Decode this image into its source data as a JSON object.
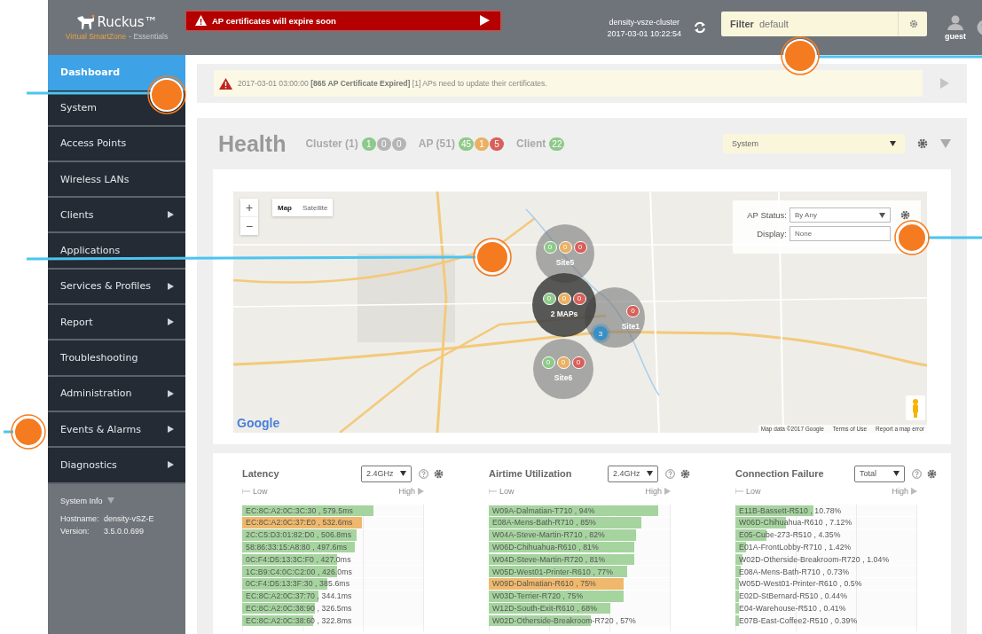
{
  "header": {
    "brand": "Ruckus™",
    "product": "Virtual SmartZone",
    "edition": "- Essentials",
    "alert": "AP certificates will expire soon",
    "cluster": "density-vsze-cluster",
    "datetime": "2017-03-01  10:22:54",
    "filter_label": "Filter",
    "filter_value": "default",
    "user": "guest"
  },
  "sidebar": {
    "items": [
      {
        "label": "Dashboard",
        "selected": true,
        "has_submenu": false
      },
      {
        "label": "System",
        "selected": false,
        "has_submenu": false
      },
      {
        "label": "Access Points",
        "selected": false,
        "has_submenu": false
      },
      {
        "label": "Wireless LANs",
        "selected": false,
        "has_submenu": false
      },
      {
        "label": "Clients",
        "selected": false,
        "has_submenu": true
      },
      {
        "label": "Applications",
        "selected": false,
        "has_submenu": false
      },
      {
        "label": "Services & Profiles",
        "selected": false,
        "has_submenu": true
      },
      {
        "label": "Report",
        "selected": false,
        "has_submenu": true
      },
      {
        "label": "Troubleshooting",
        "selected": false,
        "has_submenu": false
      },
      {
        "label": "Administration",
        "selected": false,
        "has_submenu": true
      },
      {
        "label": "Events & Alarms",
        "selected": false,
        "has_submenu": true
      },
      {
        "label": "Diagnostics",
        "selected": false,
        "has_submenu": true
      }
    ],
    "system_info": {
      "title": "System Info",
      "rows": [
        {
          "label": "Hostname:",
          "value": "density-vSZ-E"
        },
        {
          "label": "Version:",
          "value": "3.5.0.0.699"
        }
      ]
    }
  },
  "event_banner": {
    "message": "2017-03-01 03:00:00 **[865 AP Certificate Expired]** [1] APs need to update their certificates."
  },
  "health": {
    "title": "Health",
    "scope_select": "System",
    "groups": [
      {
        "label": "Cluster (1)",
        "badges": [
          {
            "value": "1",
            "color": "#8fc98a"
          },
          {
            "value": "0",
            "color": "#b5b5b5"
          },
          {
            "value": "0",
            "color": "#b5b5b5"
          }
        ]
      },
      {
        "label": "AP (51)",
        "badges": [
          {
            "value": "45",
            "color": "#8fc98a"
          },
          {
            "value": "1",
            "color": "#eab064"
          },
          {
            "value": "5",
            "color": "#d9605a"
          }
        ]
      },
      {
        "label": "Client",
        "badges": [
          {
            "value": "22",
            "color": "#8fc98a"
          }
        ]
      }
    ]
  },
  "map": {
    "zoom_in": "+",
    "zoom_out": "−",
    "map_types": [
      {
        "label": "Map",
        "selected": true
      },
      {
        "label": "Satellite",
        "selected": false
      }
    ],
    "ap_status": {
      "label": "AP Status:",
      "value": "By Any"
    },
    "display": {
      "label": "Display:",
      "value": "None"
    },
    "clusters": [
      {
        "kind": "site",
        "label": "Site5",
        "badges": [
          {
            "value": "0",
            "color": "#8fc98a"
          },
          {
            "value": "0",
            "color": "#eab064"
          },
          {
            "value": "0",
            "color": "#d9605a"
          }
        ]
      },
      {
        "kind": "site",
        "label": "Site1",
        "badges": [
          {
            "value": "0",
            "color": "#d9605a"
          }
        ]
      },
      {
        "kind": "group",
        "label": "2 MAPs",
        "badges": [
          {
            "value": "0",
            "color": "#8fc98a"
          },
          {
            "value": "0",
            "color": "#eab064"
          },
          {
            "value": "0",
            "color": "#d9605a"
          }
        ]
      },
      {
        "kind": "site",
        "label": "Site6",
        "badges": [
          {
            "value": "0",
            "color": "#8fc98a"
          },
          {
            "value": "0",
            "color": "#eab064"
          },
          {
            "value": "0",
            "color": "#d9605a"
          }
        ]
      }
    ],
    "ap_marker": "3",
    "logo": "Google",
    "attribution": "Map data ©2017 Google",
    "terms": "Terms of Use",
    "report": "Report a map error"
  },
  "widgets": [
    {
      "title": "Latency",
      "select": "2.4GHz",
      "low": "Low",
      "high": "High",
      "rows": [
        {
          "label": "EC:8C:A2:0C:3C:30 , 579.5ms",
          "level": 0.72,
          "color": "#a6d49f"
        },
        {
          "label": "EC:8C:A2:0C:37:E0 , 532.6ms",
          "level": 0.66,
          "color": "#efb86c"
        },
        {
          "label": "2C:C5:D3:01:82:D0 , 506.8ms",
          "level": 0.63,
          "color": "#a6d49f"
        },
        {
          "label": "58:86:33:15:A8:80 , 497.6ms",
          "level": 0.62,
          "color": "#a6d49f"
        },
        {
          "label": "0C:F4:D5:13:3C:F0 , 427.0ms",
          "level": 0.52,
          "color": "#a6d49f"
        },
        {
          "label": "1C:B9:C4:0C:C2:00 , 426.0ms",
          "level": 0.52,
          "color": "#a6d49f"
        },
        {
          "label": "0C:F4:D5:13:3F:30 , 385.6ms",
          "level": 0.47,
          "color": "#a6d49f"
        },
        {
          "label": "EC:8C:A2:0C:37:70 , 344.1ms",
          "level": 0.42,
          "color": "#a6d49f"
        },
        {
          "label": "EC:8C:A2:0C:38:90 , 326.5ms",
          "level": 0.4,
          "color": "#a6d49f"
        },
        {
          "label": "EC:8C:A2:0C:38:60 , 322.8ms",
          "level": 0.39,
          "color": "#a6d49f"
        }
      ]
    },
    {
      "title": "Airtime Utilization",
      "select": "2.4GHz",
      "low": "Low",
      "high": "High",
      "rows": [
        {
          "label": "W09A-Dalmatian-T710 , 94%",
          "level": 0.93,
          "color": "#a6d49f"
        },
        {
          "label": "E08A-Mens-Bath-R710 , 85%",
          "level": 0.84,
          "color": "#a6d49f"
        },
        {
          "label": "W04A-Steve-Martin-R710 , 82%",
          "level": 0.81,
          "color": "#a6d49f"
        },
        {
          "label": "W06D-Chihuahua-R610 , 81%",
          "level": 0.8,
          "color": "#a6d49f"
        },
        {
          "label": "W04D-Steve-Martin-R720 , 81%",
          "level": 0.8,
          "color": "#a6d49f"
        },
        {
          "label": "W05D-West01-Printer-R610 , 77%",
          "level": 0.76,
          "color": "#a6d49f"
        },
        {
          "label": "W09D-Dalmatian-R610 , 75%",
          "level": 0.74,
          "color": "#efb86c"
        },
        {
          "label": "W03D-Terrier-R720 , 75%",
          "level": 0.74,
          "color": "#a6d49f"
        },
        {
          "label": "W12D-South-Exit-R610 , 68%",
          "level": 0.67,
          "color": "#a6d49f"
        },
        {
          "label": "W02D-Otherside-Breakroom-R720 , 57%",
          "level": 0.56,
          "color": "#a6d49f"
        }
      ]
    },
    {
      "title": "Connection Failure",
      "select": "Total",
      "low": "Low",
      "high": "High",
      "rows": [
        {
          "label": "E11B-Bassett-R510 , 10.78%",
          "level": 0.43,
          "color": "#a6d49f"
        },
        {
          "label": "W06D-Chihuahua-R610 , 7.12%",
          "level": 0.28,
          "color": "#a6d49f"
        },
        {
          "label": "E05-Cube-273-R510 , 4.35%",
          "level": 0.17,
          "color": "#a6d49f"
        },
        {
          "label": "E01A-FrontLobby-R710 , 1.42%",
          "level": 0.06,
          "color": "#a6d49f"
        },
        {
          "label": "W02D-Otherside-Breakroom-R720 , 1.04%",
          "level": 0.04,
          "color": "#a6d49f"
        },
        {
          "label": "E08A-Mens-Bath-R710 , 0.73%",
          "level": 0.03,
          "color": "#a6d49f"
        },
        {
          "label": "W05D-West01-Printer-R610 , 0.5%",
          "level": 0.02,
          "color": "#a6d49f"
        },
        {
          "label": "E02D-StBernard-R510 , 0.44%",
          "level": 0.02,
          "color": "#a6d49f"
        },
        {
          "label": "E04-Warehouse-R510 , 0.41%",
          "level": 0.02,
          "color": "#a6d49f"
        },
        {
          "label": "E07B-East-Coffee2-R510 , 0.39%",
          "level": 0.02,
          "color": "#a6d49f"
        }
      ]
    }
  ]
}
